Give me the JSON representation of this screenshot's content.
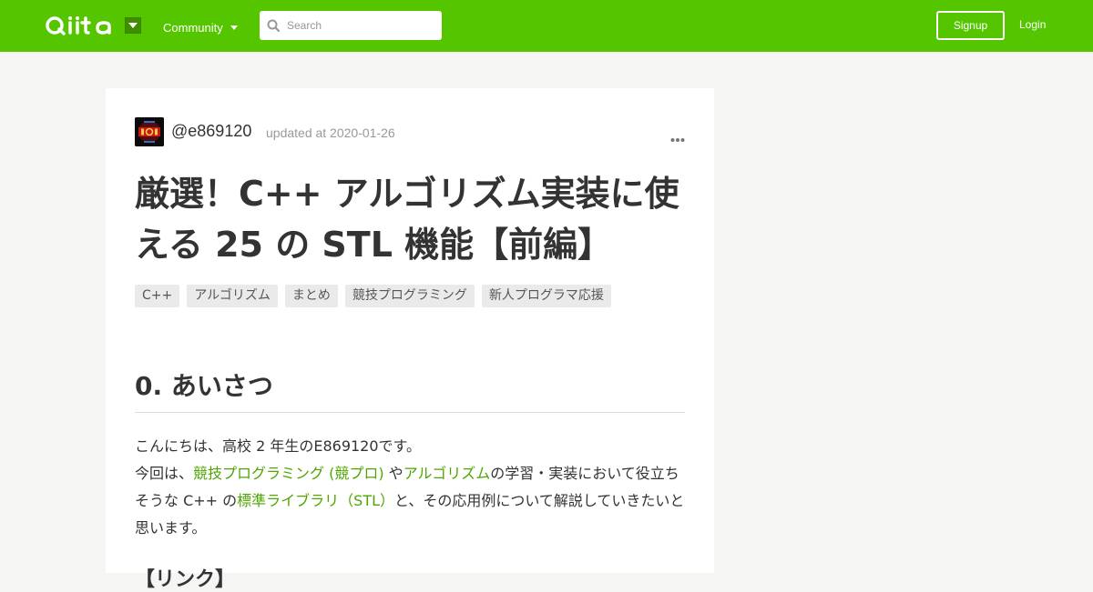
{
  "header": {
    "logo": "Qiita",
    "community_label": "Community",
    "search_placeholder": "Search",
    "signup_label": "Signup",
    "login_label": "Login"
  },
  "article": {
    "author": "@e869120",
    "updated": "updated at 2020-01-26",
    "title": "厳選！C++ アルゴリズム実装に使える 25 の STL 機能【前編】",
    "tags": [
      "C++",
      "アルゴリズム",
      "まとめ",
      "競技プログラミング",
      "新人プログラマ応援"
    ],
    "section_heading": "0. あいさつ",
    "paragraph": {
      "line1": "こんにちは、高校 2 年生のE869120です。",
      "part1": "今回は、",
      "link1": "競技プログラミング (競プロ)",
      "part2": " や",
      "link2": "アルゴリズム",
      "part3": "の学習・実装において役立ちそうな C++ の",
      "link3": "標準ライブラリ（STL）",
      "part4": "と、その応用例について解説していきたいと思います。"
    },
    "next_heading": "【リンク】"
  },
  "colors": {
    "brand": "#55c500",
    "link": "#4ea600"
  },
  "icons": [
    "qiita-logo",
    "caret-down-icon",
    "search-icon",
    "more-icon",
    "avatar"
  ]
}
